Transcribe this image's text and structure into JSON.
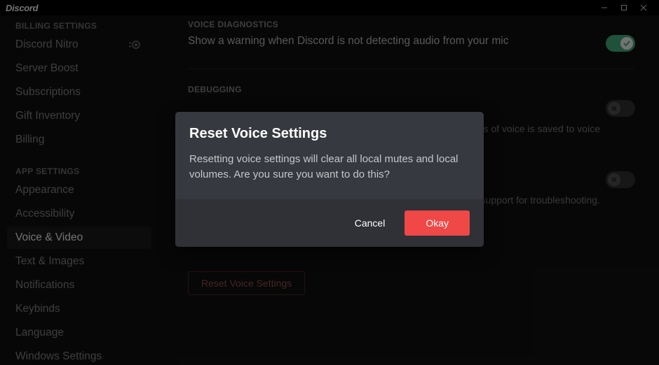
{
  "titlebar": {
    "brand": "Discord"
  },
  "sidebar": {
    "heading_billing": "BILLING SETTINGS",
    "heading_app": "APP SETTINGS",
    "items_billing": [
      {
        "label": "Discord Nitro",
        "has_badge": true
      },
      {
        "label": "Server Boost"
      },
      {
        "label": "Subscriptions"
      },
      {
        "label": "Gift Inventory"
      },
      {
        "label": "Billing"
      }
    ],
    "items_app": [
      {
        "label": "Appearance"
      },
      {
        "label": "Accessibility"
      },
      {
        "label": "Voice & Video",
        "active": true
      },
      {
        "label": "Text & Images"
      },
      {
        "label": "Notifications"
      },
      {
        "label": "Keybinds"
      },
      {
        "label": "Language"
      },
      {
        "label": "Windows Settings"
      }
    ]
  },
  "content": {
    "voice_diag_heading": "VOICE DIAGNOSTICS",
    "voice_diag_text": "Show a warning when Discord is not detecting audio from your mic",
    "debugging_heading": "DEBUGGING",
    "debug_desc_tail": "five minutes of voice is saved to voice",
    "debug_desc2_tail": "support for troubleshooting.",
    "reset_button": "Reset Voice Settings"
  },
  "modal": {
    "title": "Reset Voice Settings",
    "text": "Resetting voice settings will clear all local mutes and local volumes. Are you sure you want to do this?",
    "cancel": "Cancel",
    "okay": "Okay"
  },
  "colors": {
    "accent_green": "#43b581",
    "danger_red": "#f04747",
    "modal_bg": "#36393f"
  }
}
